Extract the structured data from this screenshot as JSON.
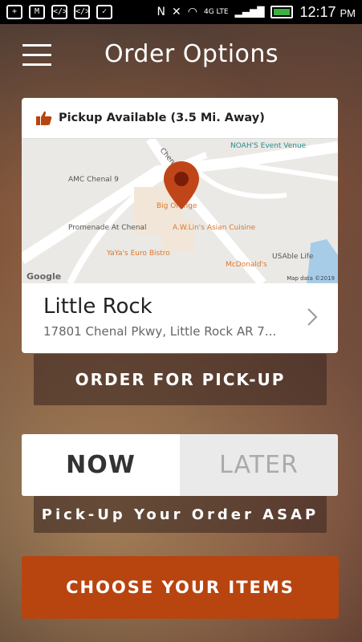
{
  "status_bar": {
    "time": "12:17",
    "ampm": "PM",
    "network": "4G LTE",
    "colors": {
      "battery": "#3cb043"
    }
  },
  "header": {
    "title": "Order Options"
  },
  "location_card": {
    "pickup_text": "Pickup Available (3.5 Mi. Away)",
    "map": {
      "labels": {
        "noahs": "NOAH'S Event Venue",
        "amc": "AMC Chenal 9",
        "chenal": "Chenal",
        "big_orange": "Big Orange",
        "promenade": "Promenade At Chenal",
        "awlins": "A.W.Lin's Asian Cuisine",
        "yayas": "YaYa's Euro Bistro",
        "mcdonalds": "McDonald's",
        "usable": "USAble Life",
        "google": "Google",
        "map_data": "Map data ©2019"
      }
    },
    "location_name": "Little Rock",
    "address": "17801 Chenal Pkwy, Little Rock AR 7..."
  },
  "actions": {
    "order_pickup": "ORDER FOR PICK-UP",
    "now": "NOW",
    "later": "LATER",
    "asap": "Pick-Up Your Order ASAP",
    "choose_items": "CHOOSE YOUR ITEMS"
  },
  "colors": {
    "accent": "#b8440f",
    "pin": "#c0461a"
  }
}
